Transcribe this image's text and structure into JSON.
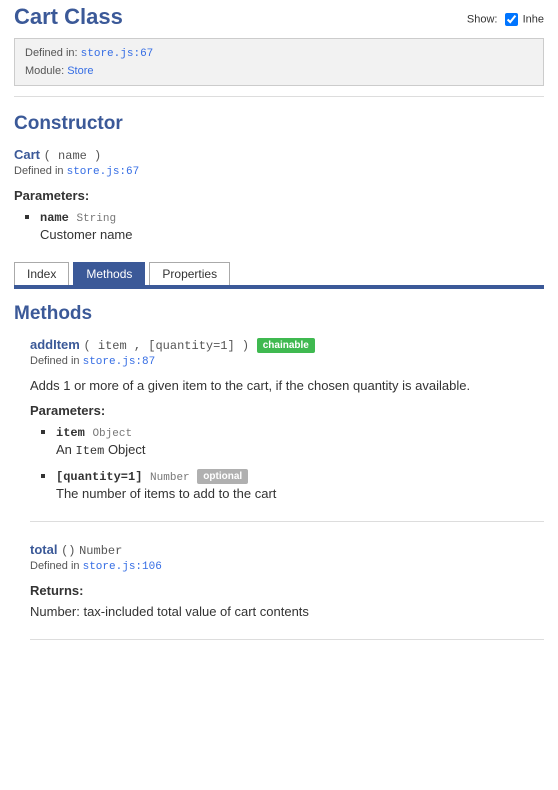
{
  "header": {
    "title": "Cart Class",
    "show_label": "Show:",
    "checkbox_label": "Inhe"
  },
  "meta": {
    "defined_in_label": "Defined in:",
    "defined_in_link": "store.js:67",
    "module_label": "Module:",
    "module_link": "Store"
  },
  "constructor": {
    "title": "Constructor",
    "name": "Cart",
    "args": "( name )",
    "defined_in_label": "Defined in",
    "defined_in_link": "store.js:67",
    "params_label": "Parameters:",
    "params": [
      {
        "name": "name",
        "type": "String",
        "desc": "Customer name"
      }
    ]
  },
  "tabs": {
    "index": "Index",
    "methods": "Methods",
    "properties": "Properties"
  },
  "methods_section": {
    "title": "Methods",
    "items": [
      {
        "name": "addItem",
        "args": "( item , [quantity=1] )",
        "badge": "chainable",
        "defined_in_label": "Defined in",
        "defined_in_link": "store.js:87",
        "desc": "Adds 1 or more of a given item to the cart, if the chosen quantity is available.",
        "params_label": "Parameters:",
        "params": [
          {
            "name": "item",
            "type": "Object",
            "desc_prefix": "An ",
            "desc_code": "Item",
            "desc_suffix": " Object"
          },
          {
            "name": "[quantity=1]",
            "type": "Number",
            "badge": "optional",
            "desc": "The number of items to add to the cart"
          }
        ]
      },
      {
        "name": "total",
        "args": "()",
        "return_type": "Number",
        "defined_in_label": "Defined in",
        "defined_in_link": "store.js:106",
        "returns_label": "Returns:",
        "returns_text": "Number: tax-included total value of cart contents"
      }
    ]
  }
}
